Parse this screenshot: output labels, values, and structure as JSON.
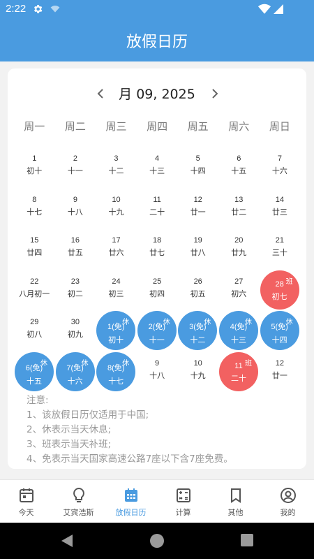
{
  "status": {
    "time": "2:22"
  },
  "app": {
    "title": "放假日历"
  },
  "calendar": {
    "month_title": "月 09, 2025",
    "weekdays": [
      "周一",
      "周二",
      "周三",
      "周四",
      "周五",
      "周六",
      "周日"
    ],
    "days": [
      {
        "num": "1",
        "lunar": "初十",
        "tag": "",
        "style": ""
      },
      {
        "num": "2",
        "lunar": "十一",
        "tag": "",
        "style": ""
      },
      {
        "num": "3",
        "lunar": "十二",
        "tag": "",
        "style": ""
      },
      {
        "num": "4",
        "lunar": "十三",
        "tag": "",
        "style": ""
      },
      {
        "num": "5",
        "lunar": "十四",
        "tag": "",
        "style": ""
      },
      {
        "num": "6",
        "lunar": "十五",
        "tag": "",
        "style": ""
      },
      {
        "num": "7",
        "lunar": "十六",
        "tag": "",
        "style": ""
      },
      {
        "num": "8",
        "lunar": "十七",
        "tag": "",
        "style": ""
      },
      {
        "num": "9",
        "lunar": "十八",
        "tag": "",
        "style": ""
      },
      {
        "num": "10",
        "lunar": "十九",
        "tag": "",
        "style": ""
      },
      {
        "num": "11",
        "lunar": "二十",
        "tag": "",
        "style": ""
      },
      {
        "num": "12",
        "lunar": "廿一",
        "tag": "",
        "style": ""
      },
      {
        "num": "13",
        "lunar": "廿二",
        "tag": "",
        "style": ""
      },
      {
        "num": "14",
        "lunar": "廿三",
        "tag": "",
        "style": ""
      },
      {
        "num": "15",
        "lunar": "廿四",
        "tag": "",
        "style": ""
      },
      {
        "num": "16",
        "lunar": "廿五",
        "tag": "",
        "style": ""
      },
      {
        "num": "17",
        "lunar": "廿六",
        "tag": "",
        "style": ""
      },
      {
        "num": "18",
        "lunar": "廿七",
        "tag": "",
        "style": ""
      },
      {
        "num": "19",
        "lunar": "廿八",
        "tag": "",
        "style": ""
      },
      {
        "num": "20",
        "lunar": "廿九",
        "tag": "",
        "style": ""
      },
      {
        "num": "21",
        "lunar": "三十",
        "tag": "",
        "style": ""
      },
      {
        "num": "22",
        "lunar": "八月初一",
        "tag": "",
        "style": ""
      },
      {
        "num": "23",
        "lunar": "初二",
        "tag": "",
        "style": ""
      },
      {
        "num": "24",
        "lunar": "初三",
        "tag": "",
        "style": ""
      },
      {
        "num": "25",
        "lunar": "初四",
        "tag": "",
        "style": ""
      },
      {
        "num": "26",
        "lunar": "初五",
        "tag": "",
        "style": ""
      },
      {
        "num": "27",
        "lunar": "初六",
        "tag": "",
        "style": ""
      },
      {
        "num": "28",
        "lunar": "初七",
        "tag": "班",
        "style": "red"
      },
      {
        "num": "29",
        "lunar": "初八",
        "tag": "",
        "style": ""
      },
      {
        "num": "30",
        "lunar": "初九",
        "tag": "",
        "style": ""
      },
      {
        "num": "1(免)",
        "lunar": "初十",
        "tag": "休",
        "style": "blue"
      },
      {
        "num": "2(免)",
        "lunar": "十一",
        "tag": "休",
        "style": "blue"
      },
      {
        "num": "3(免)",
        "lunar": "十二",
        "tag": "休",
        "style": "blue"
      },
      {
        "num": "4(免)",
        "lunar": "十三",
        "tag": "休",
        "style": "blue"
      },
      {
        "num": "5(免)",
        "lunar": "十四",
        "tag": "休",
        "style": "blue"
      },
      {
        "num": "6(免)",
        "lunar": "十五",
        "tag": "休",
        "style": "blue"
      },
      {
        "num": "7(免)",
        "lunar": "十六",
        "tag": "休",
        "style": "blue"
      },
      {
        "num": "8(免)",
        "lunar": "十七",
        "tag": "休",
        "style": "blue"
      },
      {
        "num": "9",
        "lunar": "十八",
        "tag": "",
        "style": ""
      },
      {
        "num": "10",
        "lunar": "十九",
        "tag": "",
        "style": ""
      },
      {
        "num": "11",
        "lunar": "二十",
        "tag": "班",
        "style": "red"
      },
      {
        "num": "12",
        "lunar": "廿一",
        "tag": "",
        "style": ""
      }
    ]
  },
  "notes": [
    "注意:",
    "1、该放假日历仅适用于中国;",
    "2、休表示当天休息;",
    "3、班表示当天补班;",
    "4、免表示当天国家高速公路7座以下含7座免费。"
  ],
  "bottom_nav": [
    {
      "label": "今天",
      "icon": "calendar-today-icon",
      "active": false
    },
    {
      "label": "艾宾浩斯",
      "icon": "lightbulb-icon",
      "active": false
    },
    {
      "label": "放假日历",
      "icon": "calendar-grid-icon",
      "active": true
    },
    {
      "label": "计算",
      "icon": "calculator-icon",
      "active": false
    },
    {
      "label": "其他",
      "icon": "bookmark-icon",
      "active": false
    },
    {
      "label": "我的",
      "icon": "user-icon",
      "active": false
    }
  ],
  "colors": {
    "primary": "#4a9be0",
    "holiday": "#4a9be0",
    "workday": "#f26161"
  }
}
